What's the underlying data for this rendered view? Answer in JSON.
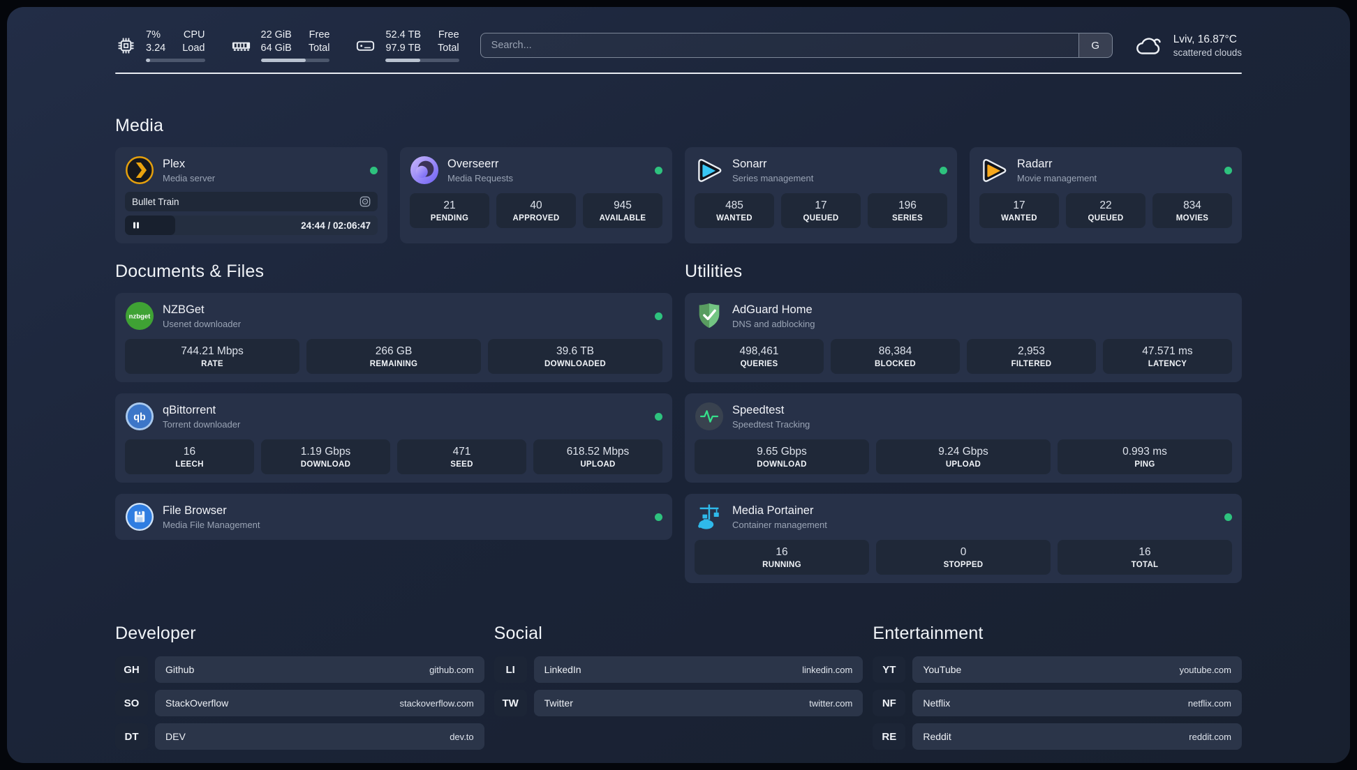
{
  "theme": {
    "status_online_color": "#2ec27e",
    "plex_accent": "#e5a00d",
    "sonarr_accent": "#38c6f4",
    "radarr_accent": "#f7a81b",
    "speedtest_pulse": "#35e08a"
  },
  "header": {
    "stats": [
      {
        "icon": "cpu-icon",
        "value": "7%",
        "secondary": "3.24",
        "label_top": "CPU",
        "label_bottom": "Load",
        "progress_pct": 7
      },
      {
        "icon": "ram-icon",
        "value": "22 GiB",
        "secondary": "64 GiB",
        "label_top": "Free",
        "label_bottom": "Total",
        "progress_pct": 65
      },
      {
        "icon": "disk-icon",
        "value": "52.4 TB",
        "secondary": "97.9 TB",
        "label_top": "Free",
        "label_bottom": "Total",
        "progress_pct": 47
      }
    ],
    "search": {
      "placeholder": "Search...",
      "engine_button": "G"
    },
    "weather": {
      "icon": "cloud-icon",
      "location": "Lviv, 16.87°C",
      "condition": "scattered clouds"
    }
  },
  "sections": {
    "media": {
      "title": "Media",
      "apps": [
        {
          "icon": "plex-icon",
          "name": "Plex",
          "subtitle": "Media server",
          "online": true,
          "player": {
            "title": "Bullet Train",
            "time": "24:44 / 02:06:47",
            "progress_pct": 20
          }
        },
        {
          "icon": "overseerr-icon",
          "name": "Overseerr",
          "subtitle": "Media Requests",
          "online": true,
          "stats": [
            {
              "value": "21",
              "label": "PENDING"
            },
            {
              "value": "40",
              "label": "APPROVED"
            },
            {
              "value": "945",
              "label": "AVAILABLE"
            }
          ]
        },
        {
          "icon": "sonarr-icon",
          "name": "Sonarr",
          "subtitle": "Series management",
          "online": true,
          "stats": [
            {
              "value": "485",
              "label": "WANTED"
            },
            {
              "value": "17",
              "label": "QUEUED"
            },
            {
              "value": "196",
              "label": "SERIES"
            }
          ]
        },
        {
          "icon": "radarr-icon",
          "name": "Radarr",
          "subtitle": "Movie management",
          "online": true,
          "stats": [
            {
              "value": "17",
              "label": "WANTED"
            },
            {
              "value": "22",
              "label": "QUEUED"
            },
            {
              "value": "834",
              "label": "MOVIES"
            }
          ]
        }
      ]
    },
    "documents": {
      "title": "Documents & Files",
      "apps": [
        {
          "icon": "nzbget-icon",
          "name": "NZBGet",
          "subtitle": "Usenet downloader",
          "online": true,
          "stats": [
            {
              "value": "744.21 Mbps",
              "label": "RATE"
            },
            {
              "value": "266 GB",
              "label": "REMAINING"
            },
            {
              "value": "39.6 TB",
              "label": "DOWNLOADED"
            }
          ]
        },
        {
          "icon": "qbittorrent-icon",
          "name": "qBittorrent",
          "subtitle": "Torrent downloader",
          "online": true,
          "stats": [
            {
              "value": "16",
              "label": "LEECH"
            },
            {
              "value": "1.19 Gbps",
              "label": "DOWNLOAD"
            },
            {
              "value": "471",
              "label": "SEED"
            },
            {
              "value": "618.52 Mbps",
              "label": "UPLOAD"
            }
          ]
        },
        {
          "icon": "filebrowser-icon",
          "name": "File Browser",
          "subtitle": "Media File Management",
          "online": true
        }
      ]
    },
    "utilities": {
      "title": "Utilities",
      "apps": [
        {
          "icon": "adguard-icon",
          "name": "AdGuard Home",
          "subtitle": "DNS and adblocking",
          "online": false,
          "stats": [
            {
              "value": "498,461",
              "label": "QUERIES"
            },
            {
              "value": "86,384",
              "label": "BLOCKED"
            },
            {
              "value": "2,953",
              "label": "FILTERED"
            },
            {
              "value": "47.571 ms",
              "label": "LATENCY"
            }
          ]
        },
        {
          "icon": "speedtest-icon",
          "name": "Speedtest",
          "subtitle": "Speedtest Tracking",
          "online": false,
          "stats": [
            {
              "value": "9.65 Gbps",
              "label": "DOWNLOAD"
            },
            {
              "value": "9.24 Gbps",
              "label": "UPLOAD"
            },
            {
              "value": "0.993 ms",
              "label": "PING"
            }
          ]
        },
        {
          "icon": "portainer-icon",
          "name": "Media Portainer",
          "subtitle": "Container management",
          "online": true,
          "stats": [
            {
              "value": "16",
              "label": "RUNNING"
            },
            {
              "value": "0",
              "label": "STOPPED"
            },
            {
              "value": "16",
              "label": "TOTAL"
            }
          ]
        }
      ]
    },
    "link_groups": [
      {
        "title": "Developer",
        "links": [
          {
            "tag": "GH",
            "name": "Github",
            "url": "github.com"
          },
          {
            "tag": "SO",
            "name": "StackOverflow",
            "url": "stackoverflow.com"
          },
          {
            "tag": "DT",
            "name": "DEV",
            "url": "dev.to"
          }
        ]
      },
      {
        "title": "Social",
        "links": [
          {
            "tag": "LI",
            "name": "LinkedIn",
            "url": "linkedin.com"
          },
          {
            "tag": "TW",
            "name": "Twitter",
            "url": "twitter.com"
          }
        ]
      },
      {
        "title": "Entertainment",
        "links": [
          {
            "tag": "YT",
            "name": "YouTube",
            "url": "youtube.com"
          },
          {
            "tag": "NF",
            "name": "Netflix",
            "url": "netflix.com"
          },
          {
            "tag": "RE",
            "name": "Reddit",
            "url": "reddit.com"
          }
        ]
      }
    ]
  }
}
